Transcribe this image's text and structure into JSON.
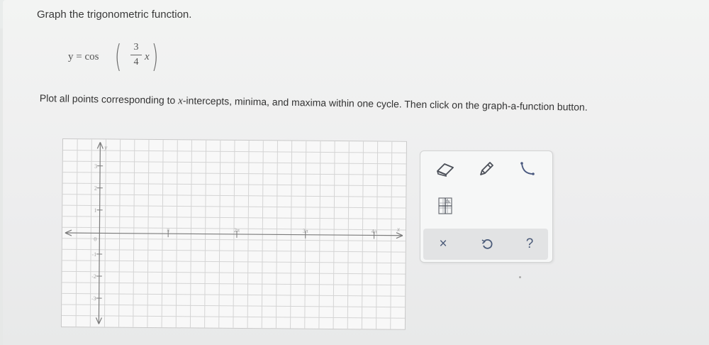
{
  "question": {
    "title": "Graph the trigonometric function.",
    "formula": {
      "lhs": "y = cos",
      "numerator": "3",
      "denominator": "4",
      "variable": "x"
    },
    "instruction_pre": "Plot all points corresponding to ",
    "instruction_var": "x",
    "instruction_post": "-intercepts, minima, and maxima within one cycle. Then click on the graph-a-function button."
  },
  "graph": {
    "x_axis_label": "x",
    "y_axis_label": "y",
    "x_ticks": [
      "π",
      "2π",
      "3π",
      "4π"
    ],
    "y_ticks": [
      "3",
      "2",
      "1",
      "0",
      "-1",
      "-2",
      "-3"
    ],
    "colors": {
      "grid": "#d4d4d4",
      "axis": "#7a7a7a",
      "tick_text": "#9a9a9a"
    }
  },
  "tools": {
    "eraser": "eraser-icon",
    "pencil": "pencil-icon",
    "curve": "curve-icon",
    "graph_function": "graph-function-icon",
    "clear": "×",
    "undo": "undo-icon",
    "help": "?"
  }
}
